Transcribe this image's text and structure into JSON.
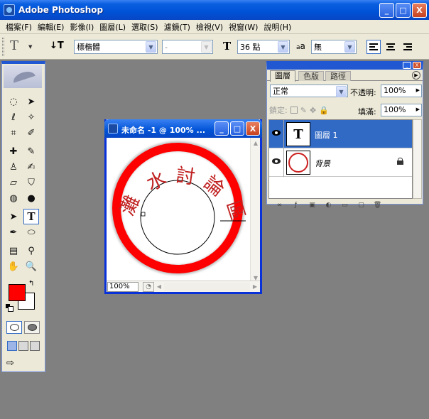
{
  "app": {
    "title": "Adobe Photoshop",
    "window_buttons": {
      "minimize": "_",
      "maximize": "□",
      "close": "X"
    }
  },
  "menu": [
    "檔案(F)",
    "編輯(E)",
    "影像(I)",
    "圖層(L)",
    "選取(S)",
    "濾鏡(T)",
    "檢視(V)",
    "視窗(W)",
    "說明(H)"
  ],
  "options_bar": {
    "tool_glyph": "T",
    "orientation_glyph": "↓T",
    "font_family": "標楷體",
    "font_style": "-",
    "size_glyph": "T",
    "font_size": "36 點",
    "aa_glyph": "a",
    "aa_glyph_b": "a",
    "anti_alias": "無"
  },
  "toolbox": {
    "tools": [
      {
        "name": "marquee-tool-icon",
        "glyph": "◌"
      },
      {
        "name": "move-tool-icon",
        "glyph": "➤"
      },
      {
        "name": "lasso-tool-icon",
        "glyph": "ℓ"
      },
      {
        "name": "magic-wand-tool-icon",
        "glyph": "✧"
      },
      {
        "name": "crop-tool-icon",
        "glyph": "⌗"
      },
      {
        "name": "slice-tool-icon",
        "glyph": "✐"
      },
      {
        "name": "healing-brush-tool-icon",
        "glyph": "✚"
      },
      {
        "name": "brush-tool-icon",
        "glyph": "✎"
      },
      {
        "name": "clone-stamp-tool-icon",
        "glyph": "♙"
      },
      {
        "name": "history-brush-tool-icon",
        "glyph": "✍"
      },
      {
        "name": "eraser-tool-icon",
        "glyph": "▱"
      },
      {
        "name": "paint-bucket-tool-icon",
        "glyph": "⛉"
      },
      {
        "name": "blur-tool-icon",
        "glyph": "◍"
      },
      {
        "name": "dodge-tool-icon",
        "glyph": "●"
      },
      {
        "name": "path-selection-tool-icon",
        "glyph": "➤"
      },
      {
        "name": "type-tool-icon",
        "glyph": "T"
      },
      {
        "name": "pen-tool-icon",
        "glyph": "✒"
      },
      {
        "name": "ellipse-tool-icon",
        "glyph": "⬭"
      },
      {
        "name": "notes-tool-icon",
        "glyph": "▤"
      },
      {
        "name": "eyedropper-tool-icon",
        "glyph": "⚲"
      },
      {
        "name": "hand-tool-icon",
        "glyph": "✋"
      },
      {
        "name": "zoom-tool-icon",
        "glyph": "🔍"
      }
    ],
    "foreground_color": "#ff0000",
    "background_color": "#ffffff",
    "swap_glyph": "↰",
    "jump_glyph": "⇨"
  },
  "document": {
    "title": "未命名 -1 @ 100% ...",
    "zoom": "100%",
    "status_glyph": "◔",
    "stamp_text": [
      "灘",
      "水",
      "討",
      "論",
      "區"
    ],
    "stamp_ring_color": "#ff0000",
    "stamp_text_color": "#c02020"
  },
  "layers_panel": {
    "tabs": [
      "圖層",
      "色版",
      "路徑"
    ],
    "panel_menu_glyph": "▶",
    "blend_mode": "正常",
    "opacity_label": "不透明:",
    "opacity": "100%",
    "lock_label": "鎖定:",
    "fill_label": "填滿:",
    "fill": "100%",
    "layers": [
      {
        "name": "圖層 1",
        "thumb": "T",
        "selected": true
      },
      {
        "name": "背景",
        "selected": false,
        "locked": true
      }
    ],
    "bottom_icons": [
      "∞",
      "ƒ",
      "▣",
      "◐",
      "▭",
      "▢",
      "🗑"
    ]
  }
}
